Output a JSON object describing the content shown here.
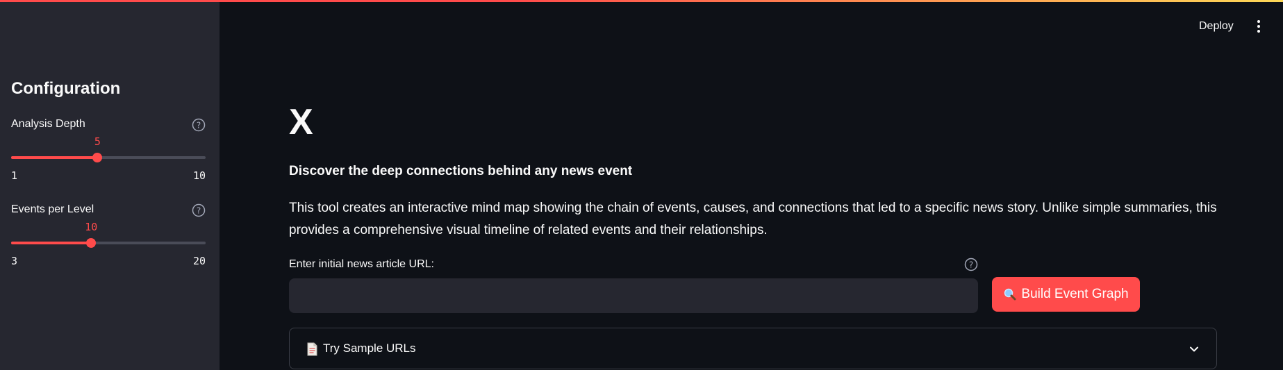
{
  "header": {
    "deploy_label": "Deploy",
    "menu_icon": "kebab-menu-icon"
  },
  "sidebar": {
    "title": "Configuration",
    "sliders": [
      {
        "label": "Analysis Depth",
        "value": "5",
        "min": "1",
        "max": "10",
        "value_num": 5,
        "min_num": 1,
        "max_num": 10
      },
      {
        "label": "Events per Level",
        "value": "10",
        "min": "3",
        "max": "20",
        "value_num": 10,
        "min_num": 3,
        "max_num": 20
      }
    ]
  },
  "main": {
    "title": "X",
    "subtitle": "Discover the deep connections behind any news event",
    "description": "This tool creates an interactive mind map showing the chain of events, causes, and connections that led to a specific news story. Unlike simple summaries, this provides a comprehensive visual timeline of related events and their relationships.",
    "url_input": {
      "label": "Enter initial news article URL:",
      "value": "",
      "placeholder": ""
    },
    "build_button": {
      "icon": "magnifier-icon",
      "label": "Build Event Graph"
    },
    "expander": {
      "icon": "document-icon",
      "label": "Try Sample URLs"
    }
  },
  "colors": {
    "accent": "#ff4b4b",
    "background": "#0e1117",
    "sidebar": "#262730"
  }
}
